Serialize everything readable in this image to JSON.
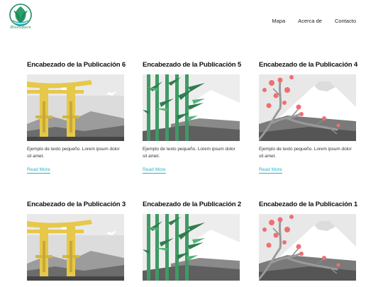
{
  "brand": {
    "logo_text": "BlueSpace",
    "accent_color": "#2bb3c9",
    "logo_color": "#1f8a5f"
  },
  "nav": {
    "items": [
      {
        "label": "Mapa"
      },
      {
        "label": "Acerca de"
      },
      {
        "label": "Contacto"
      }
    ]
  },
  "posts": [
    {
      "title": "Encabezado de la Publicación 6",
      "image": "torii-gate-illustration",
      "excerpt": "Ejemplo de texto pequeño. Lorem ipsum dolor sit amet.",
      "link": "Read More"
    },
    {
      "title": "Encabezado de la Publicación 5",
      "image": "bamboo-illustration",
      "excerpt": "Ejemplo de texto pequeño. Lorem ipsum dolor sit amet.",
      "link": "Read More"
    },
    {
      "title": "Encabezado de la Publicación 4",
      "image": "cherry-blossom-mountain-illustration",
      "excerpt": "Ejemplo de texto pequeño. Lorem ipsum dolor sit amet.",
      "link": "Read More"
    },
    {
      "title": "Encabezado de la Publicación 3",
      "image": "torii-gate-illustration",
      "excerpt": "",
      "link": ""
    },
    {
      "title": "Encabezado de la Publicación 2",
      "image": "bamboo-illustration",
      "excerpt": "",
      "link": ""
    },
    {
      "title": "Encabezado de la Publicación 1",
      "image": "cherry-blossom-mountain-illustration",
      "excerpt": "",
      "link": ""
    }
  ]
}
